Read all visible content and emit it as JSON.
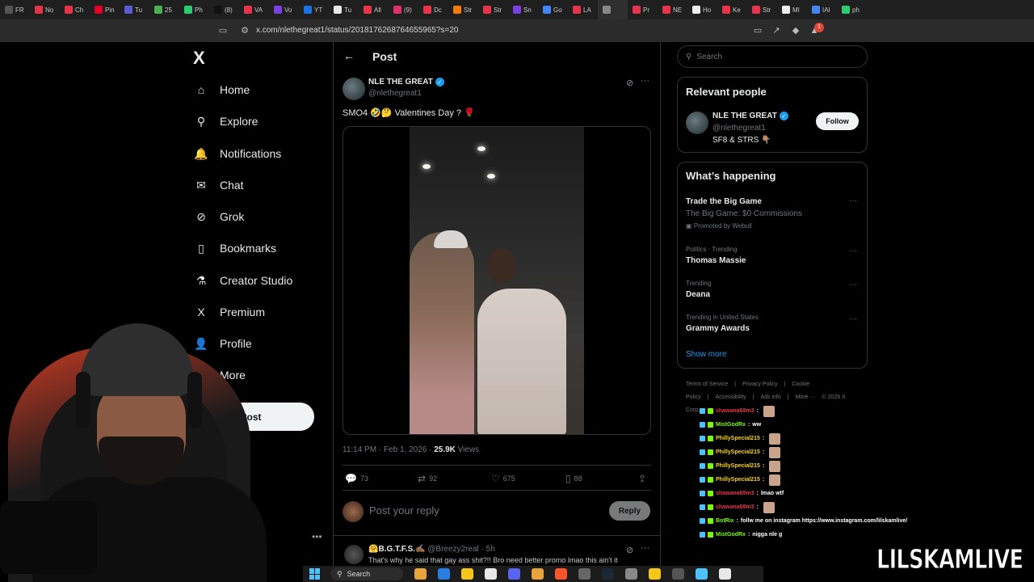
{
  "browser": {
    "tabs": [
      {
        "label": "FR",
        "color": "#555555"
      },
      {
        "label": "No",
        "color": "#e8334a"
      },
      {
        "label": "Ch",
        "color": "#e8334a"
      },
      {
        "label": "Pin",
        "color": "#e60023"
      },
      {
        "label": "Tu",
        "color": "#5b5bd6"
      },
      {
        "label": "25",
        "color": "#4caf50"
      },
      {
        "label": "Ph",
        "color": "#2ecc71"
      },
      {
        "label": "(8)",
        "color": "#111111"
      },
      {
        "label": "VA",
        "color": "#e8334a"
      },
      {
        "label": "Vo",
        "color": "#7b3fe4"
      },
      {
        "label": "YT",
        "color": "#1a73e8"
      },
      {
        "label": "Tu",
        "color": "#e8e8e8"
      },
      {
        "label": "All",
        "color": "#e8334a"
      },
      {
        "label": "(9)",
        "color": "#e1306c"
      },
      {
        "label": "Dc",
        "color": "#e8334a"
      },
      {
        "label": "Str",
        "color": "#f57c00"
      },
      {
        "label": "Str",
        "color": "#e8334a"
      },
      {
        "label": "Sn",
        "color": "#7b3fe4"
      },
      {
        "label": "Go",
        "color": "#4285f4"
      },
      {
        "label": "LA",
        "color": "#e8334a"
      },
      {
        "label": "",
        "color": "#888888"
      },
      {
        "label": "Pr",
        "color": "#e8334a"
      },
      {
        "label": "NE",
        "color": "#e8334a"
      },
      {
        "label": "Ho",
        "color": "#eeeeee"
      },
      {
        "label": "Ke",
        "color": "#e8334a"
      },
      {
        "label": "Str",
        "color": "#e8334a"
      },
      {
        "label": "MI",
        "color": "#eeeeee"
      },
      {
        "label": "IAI",
        "color": "#4285f4"
      },
      {
        "label": "ph",
        "color": "#2ecc71"
      }
    ],
    "url": "x.com/nlethegreat1/status/2018176268764655965?s=20",
    "extension_badge": "1"
  },
  "nav": {
    "logo": "X",
    "items": [
      {
        "label": "Home",
        "icon": "home-icon",
        "glyph": "⌂"
      },
      {
        "label": "Explore",
        "icon": "search-icon",
        "glyph": "⚲"
      },
      {
        "label": "Notifications",
        "icon": "bell-icon",
        "glyph": "🔔"
      },
      {
        "label": "Chat",
        "icon": "mail-icon",
        "glyph": "✉"
      },
      {
        "label": "Grok",
        "icon": "grok-icon",
        "glyph": "⊘"
      },
      {
        "label": "Bookmarks",
        "icon": "bookmark-icon",
        "glyph": "▯"
      },
      {
        "label": "Creator Studio",
        "icon": "flask-icon",
        "glyph": "⚗"
      },
      {
        "label": "Premium",
        "icon": "x-premium-icon",
        "glyph": "X"
      },
      {
        "label": "Profile",
        "icon": "person-icon",
        "glyph": "👤"
      },
      {
        "label": "More",
        "icon": "more-circle-icon",
        "glyph": "⋯"
      }
    ],
    "post_button": "Post"
  },
  "post": {
    "header": "Post",
    "author_name": "NLE THE GREAT",
    "author_handle": "@nlethegreat1",
    "text": "SMO4 🤣🤔 Valentines Day ? 🌹",
    "time": "11:14 PM · Feb 1, 2026 · ",
    "views_count": "25.9K",
    "views_label": " Views",
    "replies": "73",
    "reposts": "92",
    "likes": "675",
    "bookmarks": "88",
    "reply_placeholder": "Post your reply",
    "reply_button": "Reply"
  },
  "first_reply": {
    "name": "🤗B.G.T.F.S.✍🏾",
    "handle": "@Breezy2real · 5h",
    "text": "That's why he said that gay ass shit?!! Bro need better promo lmao this ain't it"
  },
  "sidebar": {
    "search_placeholder": "Search",
    "relevant_title": "Relevant people",
    "person_name": "NLE THE GREAT",
    "person_handle": "@nlethegreat1",
    "person_bio": "SF8 & STRS 👇🏽",
    "follow_label": "Follow",
    "happening_title": "What’s happening",
    "trends": [
      {
        "sub": "",
        "title": "Trade the Big Game",
        "desc": "The Big Game: $0 Commissions",
        "promo": "Promoted by Webull"
      },
      {
        "sub": "Politics · Trending",
        "title": "Thomas Massie"
      },
      {
        "sub": "Trending",
        "title": "Deana"
      },
      {
        "sub": "Trending in United States",
        "title": "Grammy Awards"
      }
    ],
    "show_more": "Show more",
    "footer": [
      "Terms of Service",
      "|",
      "Privacy Policy",
      "|",
      "Cookie Policy",
      "|",
      "Accessibility",
      "|",
      "Ads info",
      "|",
      "More ···",
      "© 2026 X Corp."
    ]
  },
  "chat": [
    {
      "user": "shawana69m3",
      "msg": "",
      "color": "#e8334a",
      "emote": true
    },
    {
      "user": "MistGodRx",
      "msg": "ww",
      "color": "#7cfc00",
      "emote": false
    },
    {
      "user": "PhillySpecial215",
      "msg": "",
      "color": "#f7d31e",
      "emote": true
    },
    {
      "user": "PhillySpecial215",
      "msg": "",
      "color": "#f7d31e",
      "emote": true
    },
    {
      "user": "PhillySpecial215",
      "msg": "",
      "color": "#f7d31e",
      "emote": true
    },
    {
      "user": "PhillySpecial215",
      "msg": "",
      "color": "#f7d31e",
      "emote": true
    },
    {
      "user": "shawana69m3",
      "msg": "lmao wtf",
      "color": "#e8334a",
      "emote": false
    },
    {
      "user": "shawana69m3",
      "msg": "",
      "color": "#e8334a",
      "emote": true
    },
    {
      "user": "BotRix",
      "msg": "follw me on instagram https://www.instagram.com/lilskamlive/",
      "color": "#7cfc00",
      "emote": false
    },
    {
      "user": "MistGodRx",
      "msg": "nigga nle g",
      "color": "#7cfc00",
      "emote": false
    }
  ],
  "taskbar": {
    "search_label": "Search",
    "apps": [
      "#e7a33c",
      "#2a7de1",
      "#f5c518",
      "#e8e8e8",
      "#5865f2",
      "#e8a43a",
      "#fb542b",
      "#666666",
      "#1b2838",
      "#888888",
      "#f5c518",
      "#555555",
      "#4cc2ff",
      "#e8e8e8"
    ]
  },
  "overlay_brand": "LILSKAMLIVE"
}
